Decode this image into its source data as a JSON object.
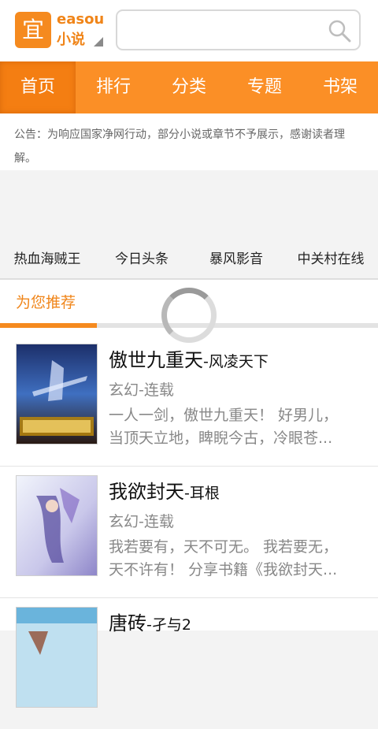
{
  "header": {
    "logo_char": "宜",
    "logo_en": "easou",
    "logo_cn": "小说",
    "search_value": ""
  },
  "nav": {
    "items": [
      "首页",
      "排行",
      "分类",
      "专题",
      "书架"
    ]
  },
  "notice": "公告：为响应国家净网行动，部分小说或章节不予展示，感谢读者理解。",
  "quick_links": [
    "热血海贼王",
    "今日头条",
    "暴风影音",
    "中关村在线"
  ],
  "recommend": {
    "title": "为您推荐",
    "books": [
      {
        "title": "傲世九重天",
        "author": "-风凌天下",
        "category": "玄幻-连载",
        "desc_line1": "一人一剑，傲世九重天！ 好男儿，",
        "desc_line2": "当顶天立地，睥睨今古，冷眼苍..."
      },
      {
        "title": "我欲封天",
        "author": "-耳根",
        "category": "玄幻-连载",
        "desc_line1": "我若要有，天不可无。 我若要无，",
        "desc_line2": "天不许有！ 分享书籍《我欲封天..."
      },
      {
        "title": "唐砖",
        "author": "-孑与2",
        "category": "",
        "desc_line1": "",
        "desc_line2": ""
      }
    ]
  },
  "colors": {
    "accent": "#f58a1f",
    "nav_bg": "#fb8f26",
    "nav_active": "#f47e12"
  }
}
